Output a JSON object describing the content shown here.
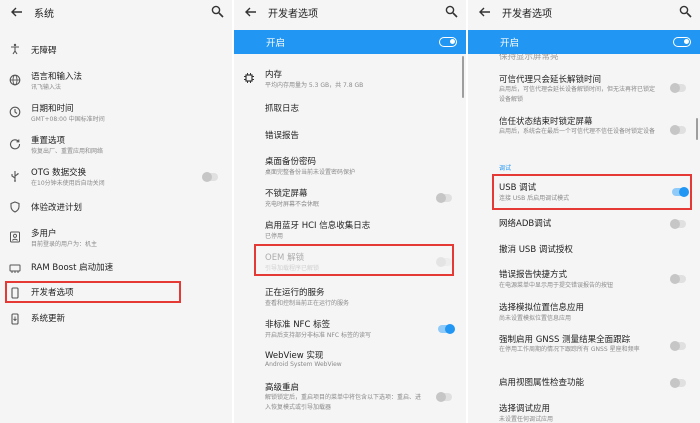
{
  "colors": {
    "accent": "#2196f3",
    "highlight": "#e53935"
  },
  "p1": {
    "title": "系统",
    "items": [
      {
        "label": "无障碍",
        "sub": ""
      },
      {
        "label": "语言和输入法",
        "sub": "讯飞输入法"
      },
      {
        "label": "日期和时间",
        "sub": "GMT+08:00 中国标准时间"
      },
      {
        "label": "重置选项",
        "sub": "恢复出厂、重置应用和网络"
      },
      {
        "label": "OTG 数据交换",
        "sub": "在10分钟未使用后自动关闭"
      },
      {
        "label": "体验改进计划",
        "sub": ""
      },
      {
        "label": "多用户",
        "sub": "目前登录的用户为：机主"
      },
      {
        "label": "RAM Boost 启动加速",
        "sub": ""
      },
      {
        "label": "开发者选项",
        "sub": ""
      },
      {
        "label": "系统更新",
        "sub": ""
      }
    ]
  },
  "p2": {
    "title": "开发者选项",
    "switch_label": "开启",
    "memory": {
      "label": "内存",
      "sub": "平均内存用量为 5.3 GB，共 7.8 GB"
    },
    "items": [
      {
        "label": "抓取日志",
        "sub": ""
      },
      {
        "label": "错误报告",
        "sub": ""
      },
      {
        "label": "桌面备份密码",
        "sub": "桌面完整备份当前未设置密码保护"
      },
      {
        "label": "不锁定屏幕",
        "sub": "充电时屏幕不会休眠"
      },
      {
        "label": "启用蓝牙 HCI 信息收集日志",
        "sub": "已停用"
      },
      {
        "label": "OEM 解锁",
        "sub": "引导加载程序已解锁"
      },
      {
        "label": "正在运行的服务",
        "sub": "查看和控制当前正在运行的服务"
      },
      {
        "label": "非标准 NFC 标签",
        "sub": "开启后支持部分非标准 NFC 标签的读写"
      },
      {
        "label": "WebView 实现",
        "sub": "Android System WebView"
      },
      {
        "label": "高级重启",
        "sub": "解锁锁定后，重启项目的菜单中将包含以下选项：重启、进入恢复模式或引导加载器"
      }
    ]
  },
  "p3": {
    "title": "开发者选项",
    "switch_label": "开启",
    "cut_label": "保持显示屏常亮",
    "items": [
      {
        "label": "可信代理只会延长解锁时间",
        "sub": "启用后，可信代理会延长设备解锁时间，但无法再将已锁定设备解锁"
      },
      {
        "label": "信任状态结束时锁定屏幕",
        "sub": "启用后，系统会在最后一个可信代理不信任设备时锁定设备"
      }
    ],
    "category": "调试",
    "usb": {
      "label": "USB 调试",
      "sub": "连接 USB 后启用调试模式"
    },
    "items2": [
      {
        "label": "网络ADB调试",
        "sub": ""
      },
      {
        "label": "撤消 USB 调试授权",
        "sub": ""
      },
      {
        "label": "错误报告快捷方式",
        "sub": "在电源菜单中显示用于提交错误报告的按钮"
      },
      {
        "label": "选择模拟位置信息应用",
        "sub": "尚未设置模拟位置信息应用"
      },
      {
        "label": "强制启用 GNSS 测量结果全面跟踪",
        "sub": "在停用工作周期的情况下跟踪所有 GNSS 星座和频率"
      },
      {
        "label": "启用视图属性检查功能",
        "sub": ""
      },
      {
        "label": "选择调试应用",
        "sub": "未设置任何调试应用"
      }
    ]
  }
}
